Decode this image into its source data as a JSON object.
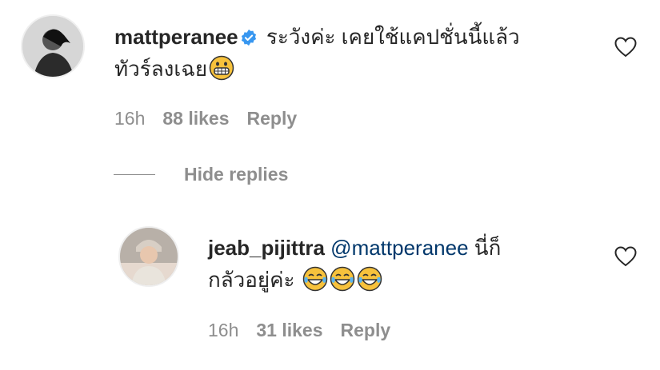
{
  "comment": {
    "username": "mattperanee",
    "verified": true,
    "text_line1": "ระวังค่ะ เคยใช้แคปชั่นนี้แล้ว",
    "text_line2": "ทัวร์ลงเฉย",
    "emoji": "grimacing-face",
    "time": "16h",
    "likes": "88 likes",
    "reply_label": "Reply"
  },
  "hide_replies_label": "Hide replies",
  "reply": {
    "username": "jeab_pijittra",
    "mention": "@mattperanee",
    "text_line1_suffix": "นี่ก็",
    "text_line2": "กลัวอยู่ค่ะ",
    "emojis": [
      "face-with-tears-of-joy",
      "face-with-tears-of-joy",
      "face-with-tears-of-joy"
    ],
    "time": "16h",
    "likes": "31 likes",
    "reply_label": "Reply"
  },
  "colors": {
    "text": "#262626",
    "muted": "#8e8e8e",
    "mention": "#00376b",
    "verified": "#3897f0"
  }
}
